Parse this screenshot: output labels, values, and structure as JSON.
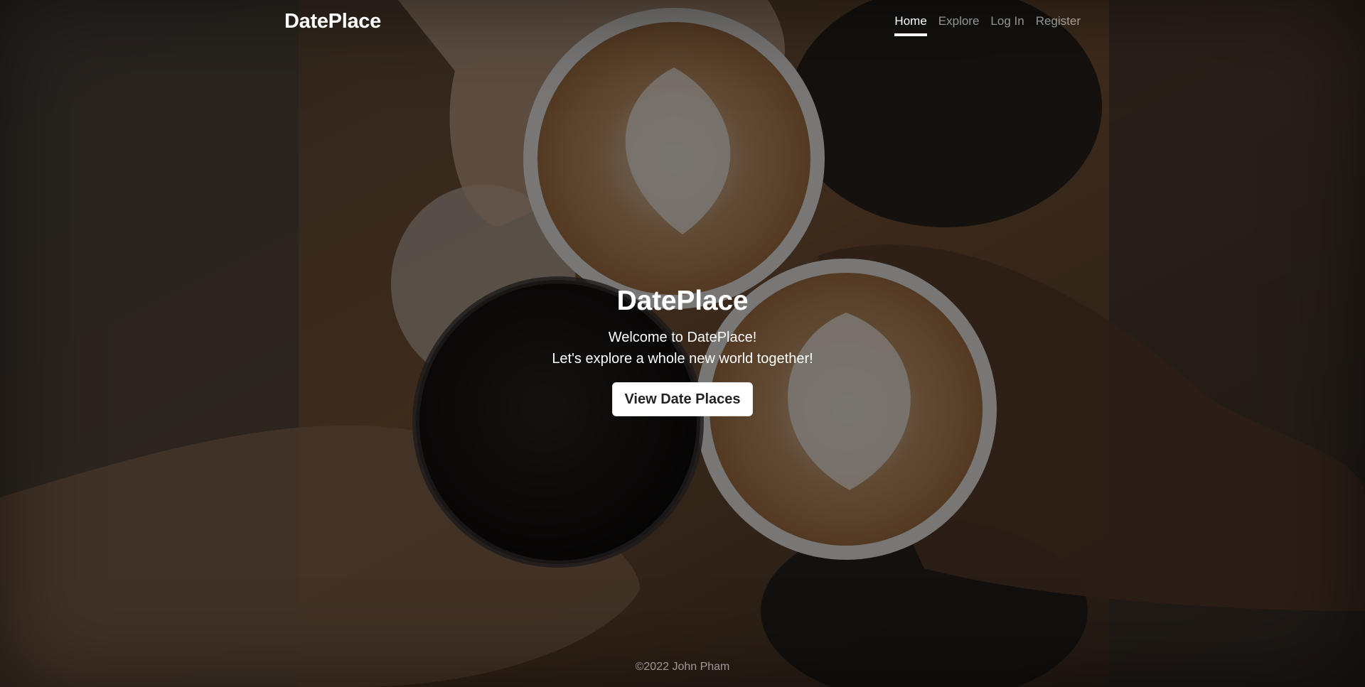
{
  "brand": "DatePlace",
  "nav": {
    "items": [
      {
        "label": "Home",
        "active": true
      },
      {
        "label": "Explore",
        "active": false
      },
      {
        "label": "Log In",
        "active": false
      },
      {
        "label": "Register",
        "active": false
      }
    ]
  },
  "hero": {
    "title": "DatePlace",
    "line1": "Welcome to DatePlace!",
    "line2": "Let's explore a whole new world together!",
    "cta_label": "View Date Places"
  },
  "footer": {
    "text": "©2022 John Pham"
  },
  "background": {
    "image": "coffee-cups-toast-photo",
    "overlay_color": "#000000"
  }
}
